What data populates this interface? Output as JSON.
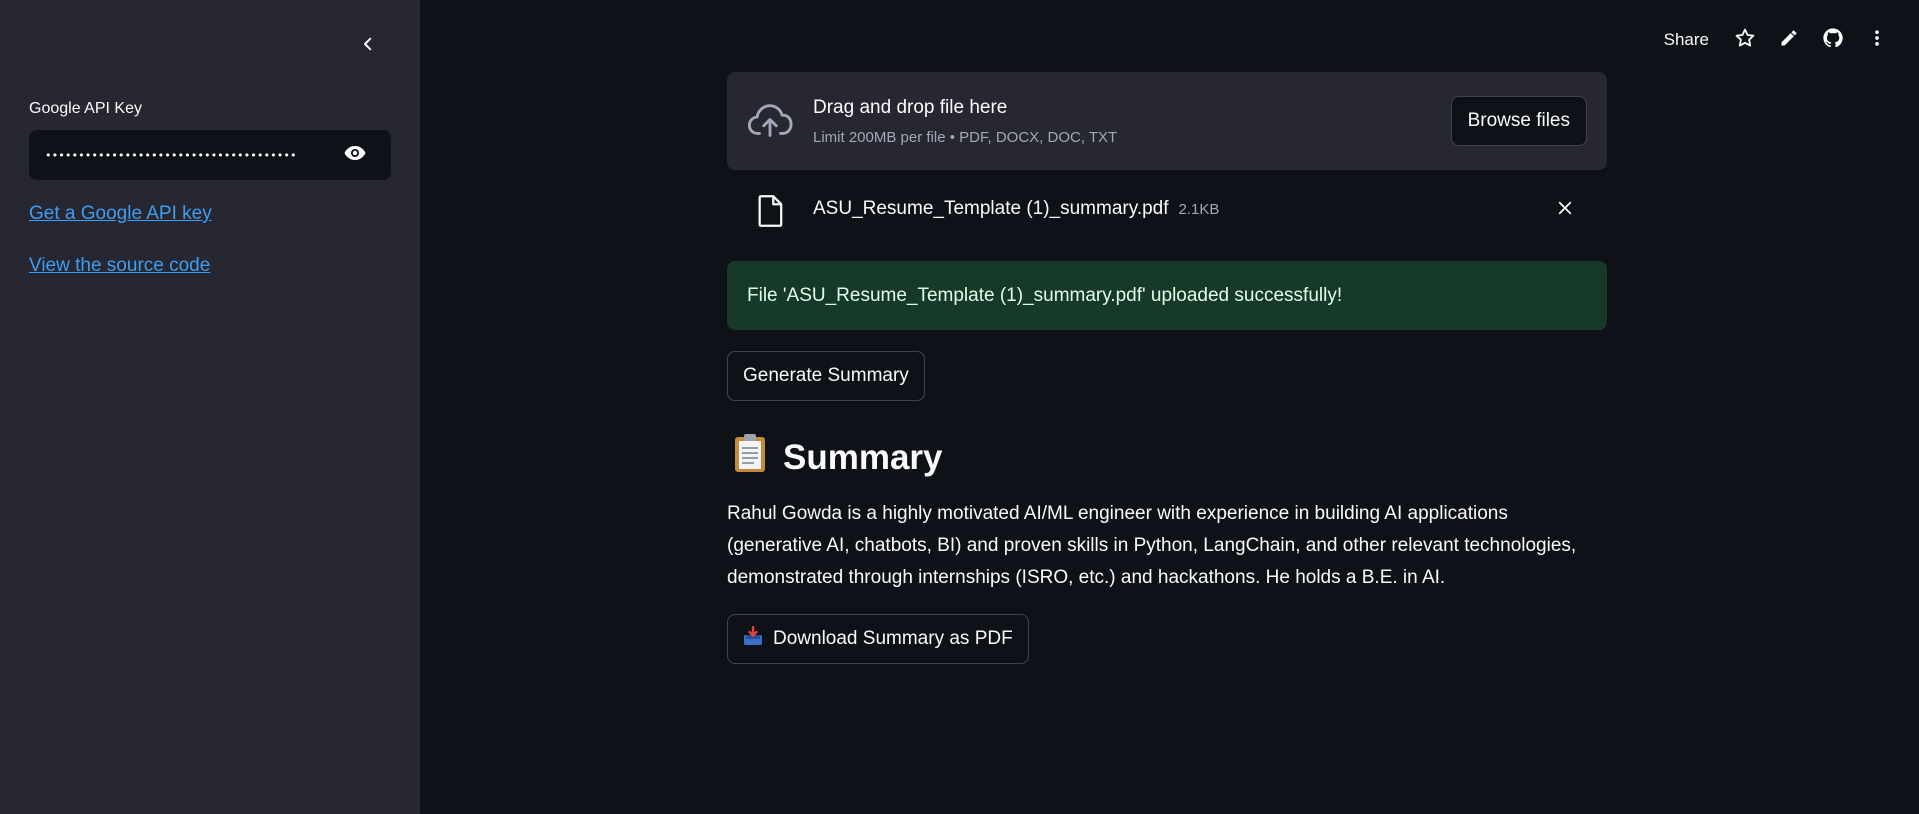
{
  "sidebar": {
    "api_key_label": "Google API Key",
    "api_key_value": "••••••••••••••••••••••••••••••••••••••",
    "links": [
      {
        "label": "Get a Google API key"
      },
      {
        "label": "View the source code"
      }
    ]
  },
  "toolbar": {
    "share_label": "Share"
  },
  "uploader": {
    "title": "Drag and drop file here",
    "subtitle": "Limit 200MB per file • PDF, DOCX, DOC, TXT",
    "browse_label": "Browse files",
    "file": {
      "name": "ASU_Resume_Template (1)_summary.pdf",
      "size": "2.1KB"
    }
  },
  "success_message": "File 'ASU_Resume_Template (1)_summary.pdf' uploaded successfully!",
  "generate_label": "Generate Summary",
  "summary": {
    "heading": "Summary",
    "text": "Rahul Gowda is a highly motivated AI/ML engineer with experience in building AI applications (generative AI, chatbots, BI) and proven skills in Python, LangChain, and other relevant technologies, demonstrated through internships (ISRO, etc.) and hackathons. He holds a B.E. in AI."
  },
  "download_label": "Download Summary as PDF",
  "colors": {
    "background": "#0e1117",
    "sidebar": "#262730",
    "link": "#3d9df3",
    "success_bg": "#173928",
    "success_text": "#dffde9"
  },
  "icons": {
    "collapse": "chevron-left-icon",
    "eye": "eye-icon",
    "star": "star-icon",
    "edit": "pencil-icon",
    "github": "github-icon",
    "menu": "more-vertical-icon",
    "upload": "cloud-upload-icon",
    "file": "file-icon",
    "close": "close-icon",
    "clipboard": "clipboard-icon",
    "inbox": "inbox-tray-icon"
  }
}
